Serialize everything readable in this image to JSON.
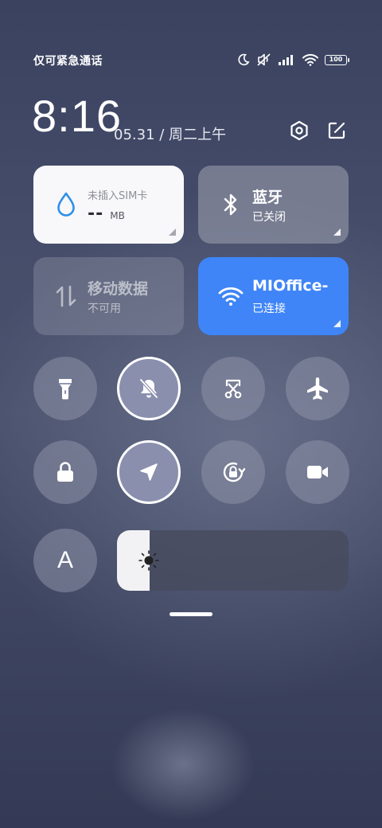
{
  "status_bar": {
    "carrier_text": "仅可紧急通话",
    "battery_level": "100",
    "icons": [
      "moon-icon",
      "mute-icon",
      "signal-icon",
      "wifi-icon",
      "battery-icon"
    ]
  },
  "header": {
    "time": "8:16",
    "date": "05.31 / 周二上午",
    "icons": [
      "settings-icon",
      "edit-icon"
    ]
  },
  "tiles": {
    "data_usage": {
      "title": "未插入SIM卡",
      "value": "--",
      "unit": "MB",
      "icon": "water-drop-icon"
    },
    "bluetooth": {
      "title": "蓝牙",
      "status": "已关闭",
      "icon": "bluetooth-icon"
    },
    "mobile_data": {
      "title": "移动数据",
      "status": "不可用",
      "icon": "data-arrows-icon"
    },
    "wifi": {
      "title": "MIOffice-",
      "status": "已连接",
      "icon": "wifi-icon"
    }
  },
  "toggles": [
    {
      "name": "flashlight",
      "icon": "flashlight-icon",
      "active": false
    },
    {
      "name": "mute",
      "icon": "bell-off-icon",
      "active": true
    },
    {
      "name": "screenshot",
      "icon": "scissors-icon",
      "active": false
    },
    {
      "name": "airplane-mode",
      "icon": "airplane-icon",
      "active": false
    },
    {
      "name": "lock-screen",
      "icon": "lock-icon",
      "active": false
    },
    {
      "name": "location",
      "icon": "location-arrow-icon",
      "active": true
    },
    {
      "name": "rotation-lock",
      "icon": "rotation-lock-icon",
      "active": false
    },
    {
      "name": "screen-record",
      "icon": "video-camera-icon",
      "active": false
    }
  ],
  "brightness": {
    "auto_label": "A",
    "level": 0.14,
    "icon": "sun-icon"
  },
  "colors": {
    "accent_blue": "#3f85f8",
    "tile_white": "#f8f8fa",
    "drop_blue": "#2f8fe8"
  }
}
